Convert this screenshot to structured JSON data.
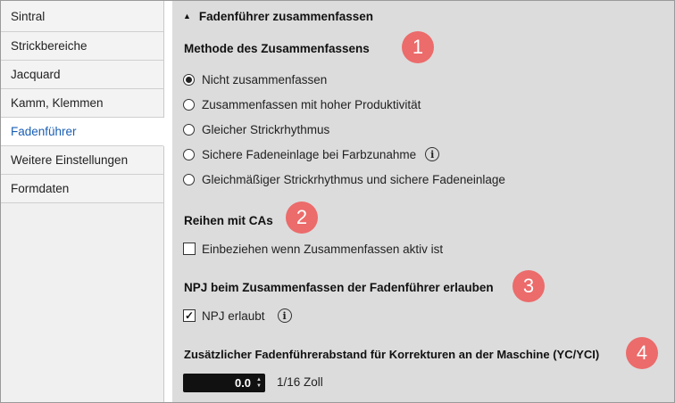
{
  "sidebar": {
    "items": [
      {
        "label": "Sintral"
      },
      {
        "label": "Strickbereiche"
      },
      {
        "label": "Jacquard"
      },
      {
        "label": "Kamm, Klemmen"
      },
      {
        "label": "Fadenführer",
        "active": true
      },
      {
        "label": "Weitere Einstellungen"
      },
      {
        "label": "Formdaten"
      }
    ]
  },
  "main": {
    "section_title": "Fadenführer zusammenfassen",
    "method": {
      "title": "Methode des Zusammenfassens",
      "options": [
        {
          "label": "Nicht zusammenfassen",
          "selected": true
        },
        {
          "label": "Zusammenfassen mit hoher Produktivität",
          "selected": false
        },
        {
          "label": "Gleicher Strickrhythmus",
          "selected": false
        },
        {
          "label": "Sichere Fadeneinlage bei Farbzunahme",
          "selected": false
        },
        {
          "label": "Gleichmäßiger Strickrhythmus und sichere Fadeneinlage",
          "selected": false
        }
      ]
    },
    "rows_with_cas": {
      "title": "Reihen mit CAs",
      "checkbox_label": "Einbeziehen wenn Zusammenfassen aktiv ist",
      "checked": false
    },
    "npj": {
      "title": "NPJ beim Zusammenfassen der Fadenführer erlauben",
      "checkbox_label": "NPJ erlaubt",
      "checked": true
    },
    "distance": {
      "title": "Zusätzlicher Fadenführerabstand für Korrekturen an der Maschine (YC/YCI)",
      "value": "0.0",
      "unit": "1/16 Zoll"
    }
  },
  "badges": [
    "1",
    "2",
    "3",
    "4"
  ],
  "icons": {
    "info": "i",
    "check": "✓",
    "caret": "▲"
  },
  "colors": {
    "badge": "#ec6b6b",
    "active_link": "#1a5fb4",
    "panel_bg": "#dcdcdc"
  }
}
